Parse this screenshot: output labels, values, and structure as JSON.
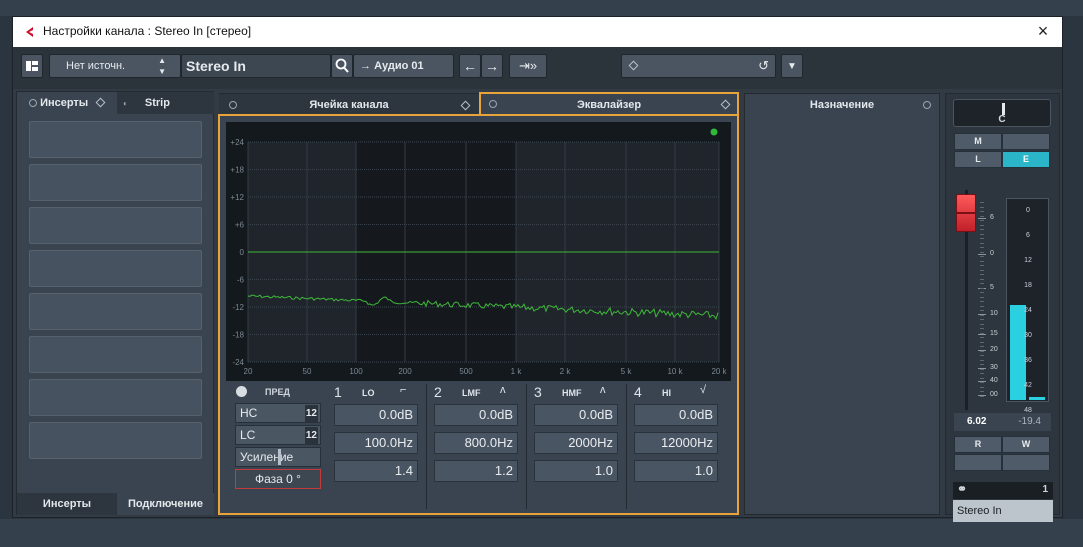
{
  "window": {
    "title": "Настройки канала : Stereo In [стерео]",
    "close_icon": "×"
  },
  "toolbar": {
    "source": "Нет источн.",
    "channel": "Stereo In",
    "route": "Аудио 01",
    "preset": "",
    "colors": {
      "accent": "#e8a33a",
      "meter": "#2bd0e0",
      "eq_curve": "#3fb83a",
      "fader": "#d9363a"
    }
  },
  "left": {
    "tab_inserts": "Инсерты",
    "tab_strip": "Strip",
    "bottom_inserts": "Инсерты",
    "bottom_connect": "Подключение",
    "slot_count": 8
  },
  "center": {
    "tab_cell": "Ячейка канала",
    "tab_eq": "Эквалайзер"
  },
  "eq": {
    "y_ticks": [
      "+24",
      "+18",
      "+12",
      "+6",
      "0",
      "-6",
      "-12",
      "-18",
      "-24"
    ],
    "x_ticks": [
      "20",
      "50",
      "100",
      "200",
      "500",
      "1 k",
      "2 k",
      "5 k",
      "10 k",
      "20 k"
    ],
    "pre_label": "ПРЕД",
    "hc": "HC",
    "lc": "LC",
    "gain": "Усиление",
    "phase": "Фаза 0 °",
    "bands": [
      {
        "num": "1",
        "name": "LO",
        "gain": "0.0dB",
        "freq": "100.0Hz",
        "q": "1.4"
      },
      {
        "num": "2",
        "name": "LMF",
        "gain": "0.0dB",
        "freq": "800.0Hz",
        "q": "1.2"
      },
      {
        "num": "3",
        "name": "HMF",
        "gain": "0.0dB",
        "freq": "2000Hz",
        "q": "1.0"
      },
      {
        "num": "4",
        "name": "HI",
        "gain": "0.0dB",
        "freq": "12000Hz",
        "q": "1.0"
      }
    ]
  },
  "routing": {
    "tab": "Назначение"
  },
  "strip": {
    "pan": "C",
    "m": "M",
    "s": "",
    "l": "L",
    "e": "E",
    "fader_scale": [
      "6",
      "0",
      "5",
      "10",
      "15",
      "20",
      "30",
      "40",
      "00"
    ],
    "meter_scale": [
      "0",
      "6",
      "12",
      "18",
      "24",
      "30",
      "36",
      "42",
      "48"
    ],
    "fader_value": "6.02",
    "meter_value": "-19.4",
    "r": "R",
    "w": "W",
    "link_num": "1",
    "name": "Stereo In",
    "meter_level": 0.47
  }
}
